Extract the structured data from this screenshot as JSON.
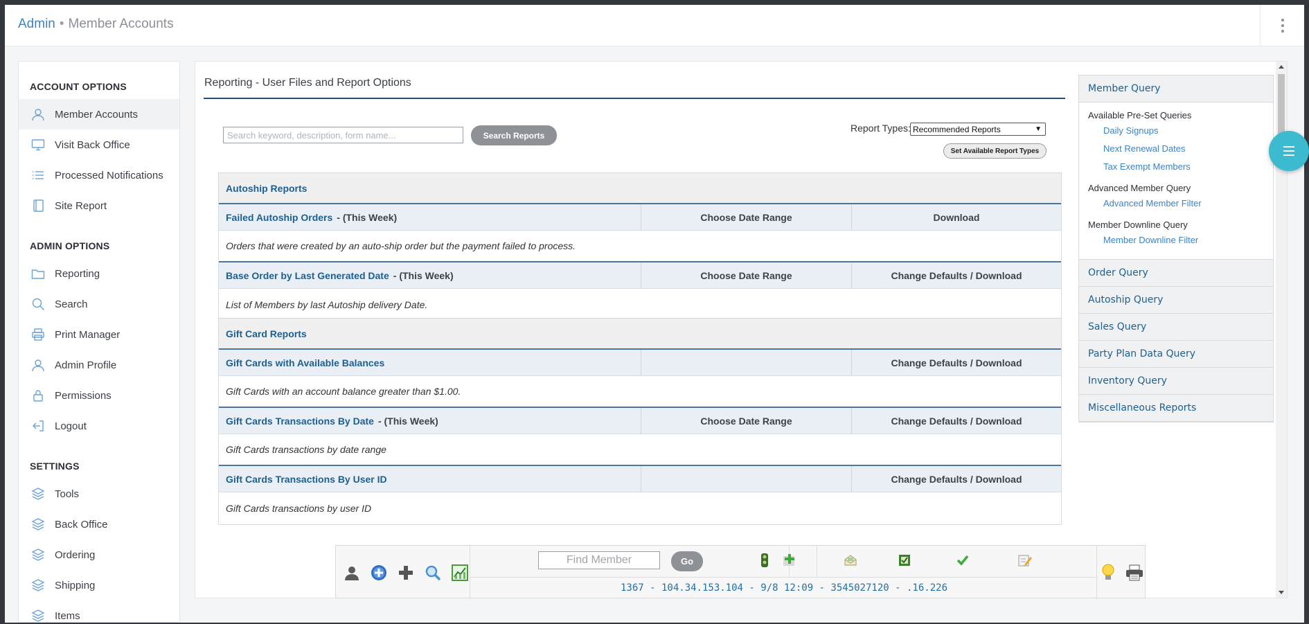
{
  "breadcrumb": {
    "root": "Admin",
    "separator": "•",
    "current": "Member Accounts"
  },
  "sidebar": {
    "sections": [
      {
        "title": "ACCOUNT OPTIONS",
        "items": [
          {
            "label": "Member Accounts",
            "icon": "user-icon",
            "active": true
          },
          {
            "label": "Visit Back Office",
            "icon": "monitor-icon"
          },
          {
            "label": "Processed Notifications",
            "icon": "list-icon"
          },
          {
            "label": "Site Report",
            "icon": "book-icon"
          }
        ]
      },
      {
        "title": "ADMIN OPTIONS",
        "items": [
          {
            "label": "Reporting",
            "icon": "folder-icon"
          },
          {
            "label": "Search",
            "icon": "search-icon"
          },
          {
            "label": "Print Manager",
            "icon": "printer-icon"
          },
          {
            "label": "Admin Profile",
            "icon": "user-icon"
          },
          {
            "label": "Permissions",
            "icon": "lock-icon"
          },
          {
            "label": "Logout",
            "icon": "logout-icon"
          }
        ]
      },
      {
        "title": "SETTINGS",
        "items": [
          {
            "label": "Tools",
            "icon": "layers-icon"
          },
          {
            "label": "Back Office",
            "icon": "layers-icon"
          },
          {
            "label": "Ordering",
            "icon": "layers-icon"
          },
          {
            "label": "Shipping",
            "icon": "layers-icon"
          },
          {
            "label": "Items",
            "icon": "layers-icon"
          }
        ]
      }
    ]
  },
  "main": {
    "heading": "Reporting - User Files and Report Options",
    "search": {
      "placeholder": "Search keyword, description, form name...",
      "value": "",
      "button": "Search Reports"
    },
    "report_types": {
      "label": "Report Types:",
      "selected": "Recommended Reports",
      "set_button": "Set Available Report Types"
    },
    "sections": [
      {
        "title": "Autoship Reports",
        "reports": [
          {
            "name": "Failed Autoship Orders",
            "period": "- (This Week)",
            "date_col": "Choose Date Range",
            "action_col": "Download",
            "description": "Orders that were created by an auto-ship order but the payment failed to process."
          },
          {
            "name": "Base Order by Last Generated Date",
            "period": "- (This Week)",
            "date_col": "Choose Date Range",
            "action_col": "Change Defaults / Download",
            "description": "List of Members by last Autoship delivery Date."
          }
        ]
      },
      {
        "title": "Gift Card Reports",
        "reports": [
          {
            "name": "Gift Cards with Available Balances",
            "period": "",
            "date_col": "",
            "action_col": "Change Defaults / Download",
            "description": "Gift Cards with an account balance greater than $1.00."
          },
          {
            "name": "Gift Cards Transactions By Date",
            "period": "- (This Week)",
            "date_col": "Choose Date Range",
            "action_col": "Change Defaults / Download",
            "description": "Gift Cards transactions by date range"
          },
          {
            "name": "Gift Cards Transactions By User ID",
            "period": "",
            "date_col": "",
            "action_col": "Change Defaults / Download",
            "description": "Gift Cards transactions by user ID"
          }
        ]
      }
    ]
  },
  "query_panel": {
    "header": "Member Query",
    "groups": [
      {
        "title": "Available Pre-Set Queries",
        "links": [
          "Daily Signups",
          "Next Renewal Dates",
          "Tax Exempt Members"
        ]
      },
      {
        "title": "Advanced Member Query",
        "links": [
          "Advanced Member Filter"
        ]
      },
      {
        "title": "Member Downline Query",
        "links": [
          "Member Downline Filter"
        ]
      }
    ],
    "items": [
      "Order Query",
      "Autoship Query",
      "Sales Query",
      "Party Plan Data Query",
      "Inventory Query",
      "Miscellaneous Reports"
    ]
  },
  "quickbar": {
    "find_placeholder": "Find Member",
    "go_label": "Go",
    "status_line": "1367 - 104.34.153.104 - 9/8 12:09 - 3545027120 - .16.226"
  },
  "colors": {
    "accent": "#3b83c2",
    "link_dark": "#1e5f8f",
    "fab": "#3bbad0",
    "section_rule": "#4a75a3"
  }
}
